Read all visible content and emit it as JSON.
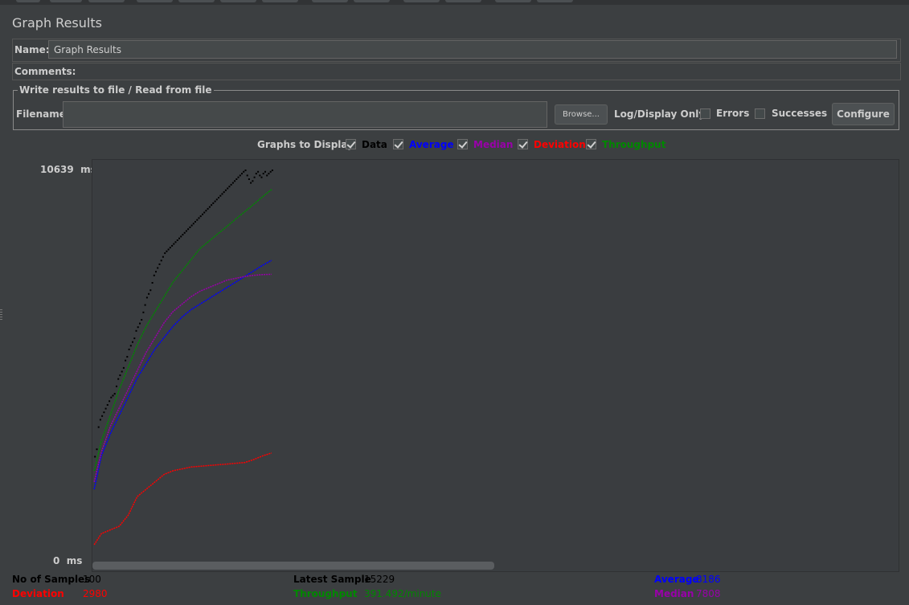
{
  "panel": {
    "title": "Graph Results",
    "name_label": "Name:",
    "name_value": "Graph Results",
    "comments_label": "Comments:"
  },
  "file": {
    "legend": "Write results to file / Read from file",
    "filename_label": "Filename",
    "filename_value": "",
    "browse_label": "Browse...",
    "log_display_label": "Log/Display Only:",
    "errors_label": "Errors",
    "successes_label": "Successes",
    "configure_label": "Configure"
  },
  "graphs": {
    "label": "Graphs to Display",
    "options": [
      {
        "label": "Data",
        "color": "#000000",
        "checked": true
      },
      {
        "label": "Average",
        "color": "#0000ff",
        "checked": true
      },
      {
        "label": "Median",
        "color": "#9900aa",
        "checked": true
      },
      {
        "label": "Deviation",
        "color": "#ff0000",
        "checked": true
      },
      {
        "label": "Throughput",
        "color": "#008800",
        "checked": true
      }
    ]
  },
  "axis": {
    "y_max": "10639",
    "y_min": "0",
    "unit": "ms"
  },
  "stats": {
    "samples_label": "No of Samples",
    "samples_value": "100",
    "latest_label": "Latest Sample",
    "latest_value": "15229",
    "average_label": "Average",
    "average_value": "8186",
    "deviation_label": "Deviation",
    "deviation_value": "2980",
    "throughput_label": "Throughput",
    "throughput_value": "391.492/minute",
    "median_label": "Median",
    "median_value": "7808"
  },
  "chart_data": {
    "type": "scatter",
    "ylim": [
      0,
      10639
    ],
    "xlim": [
      0,
      450
    ],
    "series": [
      {
        "name": "Data",
        "color": "#000000",
        "x": [
          1,
          2,
          3,
          4,
          5,
          6,
          7,
          8,
          9,
          10,
          11,
          12,
          13,
          14,
          15,
          16,
          17,
          18,
          19,
          20,
          21,
          22,
          23,
          24,
          25,
          26,
          27,
          28,
          29,
          30,
          31,
          32,
          33,
          34,
          35,
          36,
          37,
          38,
          39,
          40,
          41,
          42,
          43,
          44,
          45,
          46,
          47,
          48,
          49,
          50,
          51,
          52,
          53,
          54,
          55,
          56,
          57,
          58,
          59,
          60,
          61,
          62,
          63,
          64,
          65,
          66,
          67,
          68,
          69,
          70,
          71,
          72,
          73,
          74,
          75,
          76,
          77,
          78,
          79,
          80,
          81,
          82,
          83,
          84,
          85,
          86,
          87,
          88,
          89,
          90,
          91,
          92,
          93,
          94,
          95,
          96,
          97,
          98,
          99,
          100
        ],
        "values": [
          2900,
          3100,
          3700,
          3900,
          4000,
          4100,
          4200,
          4300,
          4400,
          4500,
          4550,
          4600,
          4800,
          5000,
          5100,
          5200,
          5300,
          5500,
          5600,
          5800,
          5900,
          6000,
          6100,
          6300,
          6400,
          6500,
          6600,
          6800,
          7000,
          7200,
          7300,
          7400,
          7600,
          7800,
          7900,
          8000,
          8100,
          8200,
          8300,
          8400,
          8450,
          8500,
          8550,
          8600,
          8650,
          8700,
          8750,
          8800,
          8850,
          8900,
          8950,
          9000,
          9050,
          9100,
          9150,
          9200,
          9250,
          9300,
          9350,
          9400,
          9450,
          9500,
          9550,
          9600,
          9650,
          9700,
          9750,
          9800,
          9850,
          9900,
          9950,
          10000,
          10050,
          10100,
          10150,
          10200,
          10250,
          10300,
          10350,
          10400,
          10450,
          10500,
          10550,
          10600,
          10639,
          10500,
          10400,
          10300,
          10350,
          10450,
          10550,
          10600,
          10500,
          10450,
          10550,
          10600,
          10500,
          10550,
          10600,
          10639
        ]
      },
      {
        "name": "Average",
        "color": "#0000ff",
        "x": [
          1,
          5,
          10,
          15,
          20,
          25,
          30,
          35,
          40,
          45,
          50,
          55,
          60,
          65,
          70,
          75,
          80,
          85,
          90,
          95,
          100
        ],
        "values": [
          2000,
          2900,
          3500,
          4000,
          4500,
          5000,
          5400,
          5800,
          6100,
          6400,
          6650,
          6850,
          7000,
          7150,
          7300,
          7450,
          7600,
          7750,
          7900,
          8050,
          8186
        ]
      },
      {
        "name": "Median",
        "color": "#9900aa",
        "x": [
          1,
          5,
          10,
          15,
          20,
          25,
          30,
          35,
          40,
          45,
          50,
          55,
          60,
          65,
          70,
          75,
          80,
          85,
          90,
          95,
          100
        ],
        "values": [
          2200,
          3000,
          3700,
          4200,
          4700,
          5200,
          5700,
          6100,
          6500,
          6800,
          7000,
          7200,
          7350,
          7450,
          7550,
          7650,
          7700,
          7750,
          7780,
          7800,
          7808
        ]
      },
      {
        "name": "Deviation",
        "color": "#ff0000",
        "x": [
          1,
          5,
          10,
          15,
          20,
          25,
          30,
          35,
          40,
          45,
          50,
          55,
          60,
          65,
          70,
          75,
          80,
          85,
          90,
          95,
          100
        ],
        "values": [
          500,
          800,
          900,
          1000,
          1300,
          1800,
          2000,
          2200,
          2400,
          2500,
          2550,
          2600,
          2620,
          2640,
          2660,
          2680,
          2700,
          2720,
          2800,
          2900,
          2980
        ]
      },
      {
        "name": "Throughput",
        "color": "#008800",
        "x": [
          1,
          5,
          10,
          15,
          20,
          25,
          30,
          35,
          40,
          45,
          50,
          55,
          60,
          65,
          70,
          75,
          80,
          85,
          90,
          95,
          100
        ],
        "values": [
          2500,
          3300,
          4000,
          4700,
          5300,
          5900,
          6400,
          6800,
          7200,
          7600,
          7900,
          8200,
          8500,
          8700,
          8900,
          9100,
          9300,
          9500,
          9700,
          9900,
          10100
        ]
      }
    ]
  }
}
